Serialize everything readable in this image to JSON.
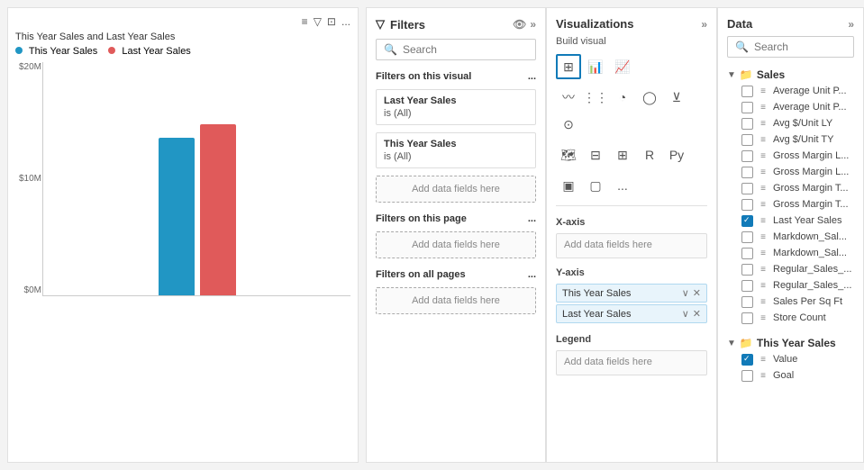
{
  "chart": {
    "title": "This Year Sales and Last Year Sales",
    "legend": [
      {
        "label": "This Year Sales",
        "color": "#2196c4"
      },
      {
        "label": "Last Year Sales",
        "color": "#e05a5a"
      }
    ],
    "y_labels": [
      "$20M",
      "$10M",
      "$0M"
    ],
    "toolbar_icons": [
      "≡",
      "▽",
      "⊡",
      "..."
    ]
  },
  "filters": {
    "header": "Filters",
    "search_placeholder": "Search",
    "filters_on_visual_label": "Filters on this visual",
    "filters_on_page_label": "Filters on this page",
    "filters_on_all_label": "Filters on all pages",
    "filter_items": [
      {
        "field": "Last Year Sales",
        "value": "is (All)"
      },
      {
        "field": "This Year Sales",
        "value": "is (All)"
      }
    ],
    "add_data_fields": "Add data fields here"
  },
  "visualizations": {
    "header": "Visualizations",
    "build_visual_label": "Build visual",
    "x_axis_label": "X-axis",
    "y_axis_label": "Y-axis",
    "legend_label": "Legend",
    "x_axis_placeholder": "Add data fields here",
    "legend_placeholder": "Add data fields here",
    "y_axis_fields": [
      {
        "name": "This Year Sales"
      },
      {
        "name": "Last Year Sales"
      }
    ]
  },
  "data": {
    "header": "Data",
    "search_placeholder": "Search",
    "groups": [
      {
        "name": "Sales",
        "items": [
          {
            "label": "Average Unit P...",
            "checked": false
          },
          {
            "label": "Average Unit P...",
            "checked": false
          },
          {
            "label": "Avg $/Unit LY",
            "checked": false
          },
          {
            "label": "Avg $/Unit TY",
            "checked": false
          },
          {
            "label": "Gross Margin L...",
            "checked": false
          },
          {
            "label": "Gross Margin L...",
            "checked": false
          },
          {
            "label": "Gross Margin T...",
            "checked": false
          },
          {
            "label": "Gross Margin T...",
            "checked": false
          },
          {
            "label": "Last Year Sales",
            "checked": true
          },
          {
            "label": "Markdown_Sal...",
            "checked": false
          },
          {
            "label": "Markdown_Sal...",
            "checked": false
          },
          {
            "label": "Regular_Sales_...",
            "checked": false
          },
          {
            "label": "Regular_Sales_...",
            "checked": false
          },
          {
            "label": "Sales Per Sq Ft",
            "checked": false
          },
          {
            "label": "Store Count",
            "checked": false
          }
        ]
      },
      {
        "name": "This Year Sales",
        "items": [
          {
            "label": "Value",
            "checked": true
          },
          {
            "label": "Goal",
            "checked": false
          }
        ]
      }
    ]
  }
}
